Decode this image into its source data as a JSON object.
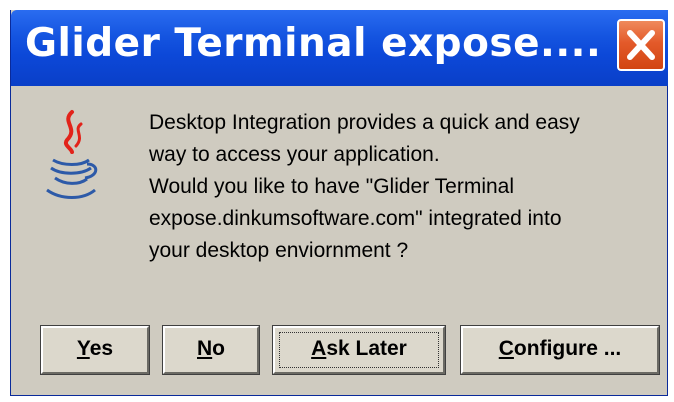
{
  "window": {
    "title": "Glider Terminal expose....",
    "close_icon": "close-icon"
  },
  "dialog": {
    "icon": "java-coffee-cup-icon",
    "message_line1": "Desktop Integration provides a quick and easy",
    "message_line2": "way to access your application.",
    "question_line1": "Would you like to have  \"Glider Terminal",
    "question_line2": "expose.dinkumsoftware.com\" integrated into",
    "question_line3": "your desktop enviornment ?"
  },
  "buttons": {
    "yes": {
      "mnemonic": "Y",
      "rest": "es"
    },
    "no": {
      "mnemonic": "N",
      "rest": "o"
    },
    "ask_later": {
      "mnemonic": "A",
      "rest": "sk Later"
    },
    "configure": {
      "mnemonic": "C",
      "rest": "onfigure ..."
    }
  },
  "colors": {
    "titlebar": "#0c48d8",
    "close_button": "#e35a2a",
    "dialog_bg": "#cfcbc0"
  }
}
